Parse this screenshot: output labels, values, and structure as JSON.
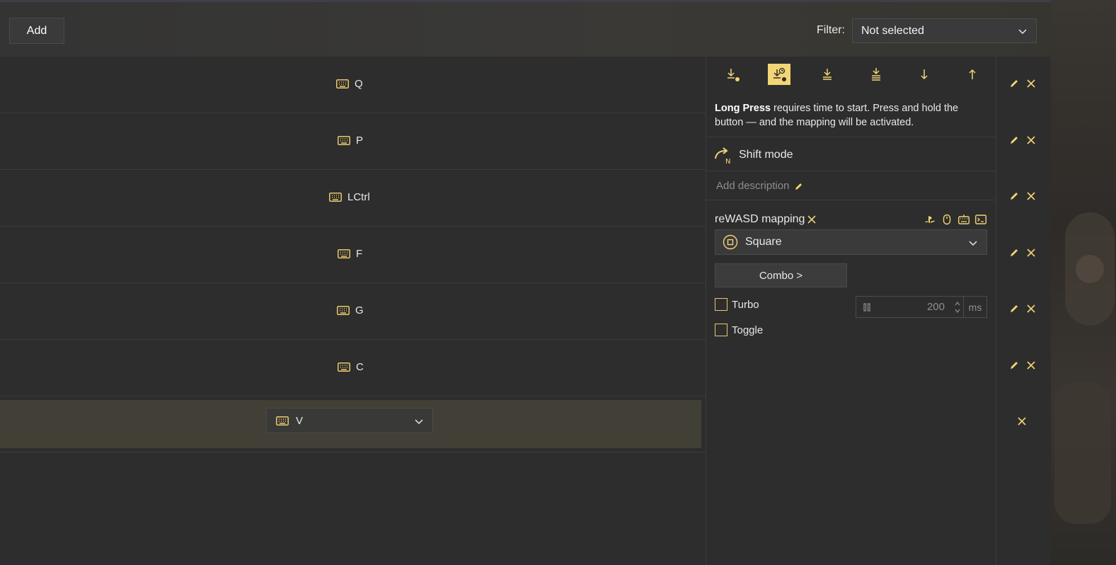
{
  "toolbar": {
    "add_label": "Add",
    "filter_label": "Filter:",
    "filter_value": "Not selected"
  },
  "rows": [
    {
      "key": "Q"
    },
    {
      "key": "P"
    },
    {
      "key": "LCtrl"
    },
    {
      "key": "F"
    },
    {
      "key": "G"
    },
    {
      "key": "C"
    }
  ],
  "selected_row": {
    "key": "V"
  },
  "panel": {
    "activation_modes": [
      "single-press-icon",
      "long-press-icon",
      "double-press-icon",
      "triple-press-icon",
      "start-press-icon",
      "release-icon"
    ],
    "active_mode": "long-press-icon",
    "description_bold": "Long Press",
    "description_rest": " requires time to start. Press and hold the button — and the mapping will be activated.",
    "shift_label": "Shift mode",
    "add_description": "Add description",
    "mapping_title": "reWASD mapping",
    "mapping_value": "Square",
    "combo_label": "Combo >",
    "turbo_label": "Turbo",
    "toggle_label": "Toggle",
    "turbo_value": "200",
    "turbo_unit": "ms"
  },
  "colors": {
    "accent": "#f2d575",
    "background": "#2d2d2d",
    "selected_row": "#423f36"
  }
}
